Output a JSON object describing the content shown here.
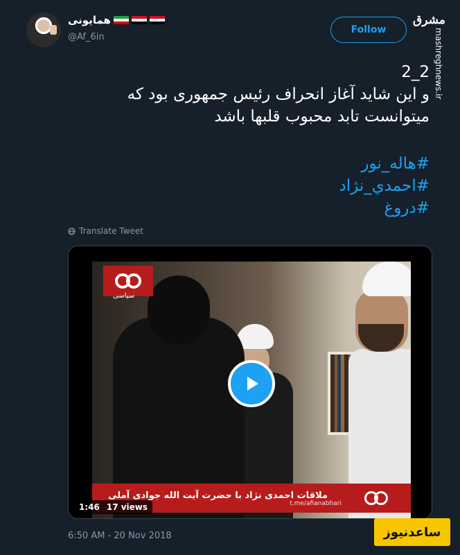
{
  "tweet": {
    "author_name": "همایونی",
    "author_handle": "@Af_6in",
    "follow_label": "Follow",
    "text_lines": [
      "2_2",
      "و این شاید آغاز انحراف رئیس جمهوری بود که",
      "میتوانست تابد محبوب قلبها باشد"
    ],
    "hashtags": [
      "#هاله_نور",
      "#احمدي_نژاد",
      "#دروغ"
    ],
    "translate_label": "Translate Tweet",
    "timestamp": "6:50 AM - 20 Nov 2018"
  },
  "video": {
    "duration": "1:46",
    "views": "17 views",
    "caption": "ملاقات احمدی نژاد با حضرت آیت الله جوادی آملی",
    "caption_small": "t.me/afianabhari",
    "logo_label": "سیاسی"
  },
  "overlay": {
    "site_logo": "مشرق",
    "site_url": "mashreghnews.ir",
    "bottom_watermark": "ساعدنیوز"
  },
  "colors": {
    "background": "#15202b",
    "accent": "#1da1f2",
    "muted": "#8899a6",
    "video_red": "#b71c1c",
    "watermark_yellow": "#f7c600"
  },
  "icons": [
    "globe-icon",
    "play-icon"
  ],
  "flags": [
    "iran-flag",
    "iraq-flag",
    "syria-flag"
  ]
}
